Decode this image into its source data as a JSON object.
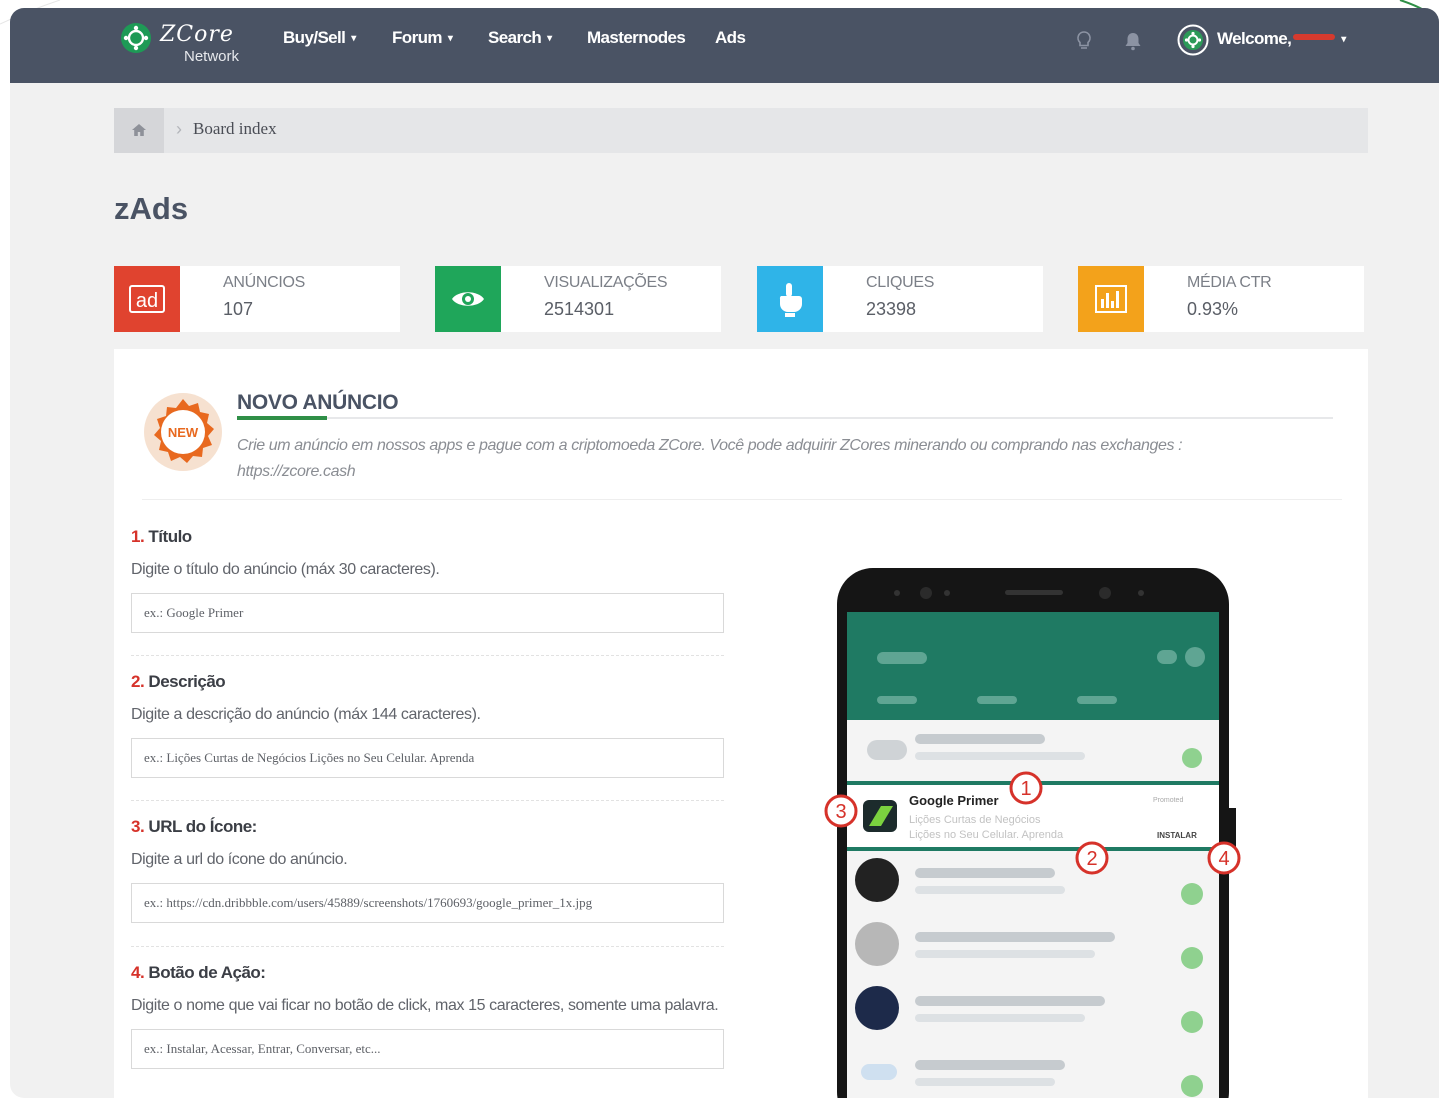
{
  "brand": {
    "logo_script": "ZCore",
    "logo_sub": "Network"
  },
  "nav": {
    "items": [
      {
        "label": "Buy/Sell",
        "dropdown": true
      },
      {
        "label": "Forum",
        "dropdown": true
      },
      {
        "label": "Search",
        "dropdown": true
      },
      {
        "label": "Masternodes",
        "dropdown": false
      },
      {
        "label": "Ads",
        "dropdown": false
      }
    ],
    "caret": "▾",
    "welcome": "Welcome,"
  },
  "breadcrumb": {
    "sep": "›",
    "label": "Board index"
  },
  "page": {
    "title": "zAds"
  },
  "stats": [
    {
      "label": "ANÚNCIOS",
      "value": "107",
      "color": "#e0432f",
      "icon": "ad-icon",
      "icon_text": "ad"
    },
    {
      "label": "VISUALIZAÇÕES",
      "value": "2514301",
      "color": "#1fa65a",
      "icon": "eye-icon"
    },
    {
      "label": "CLIQUES",
      "value": "23398",
      "color": "#2fb4e8",
      "icon": "hand-pointer-icon"
    },
    {
      "label": "MÉDIA CTR",
      "value": "0.93%",
      "color": "#f3a21b",
      "icon": "bar-chart-icon"
    }
  ],
  "new_ad": {
    "badge": "NEW",
    "title": "NOVO ANÚNCIO",
    "description": "Crie um anúncio em nossos apps e pague com a criptomoeda ZCore. Você pode adquirir ZCores minerando ou comprando nas exchanges : https://zcore.cash"
  },
  "fields": [
    {
      "num": "1.",
      "label": "Título",
      "help": "Digite o título do anúncio (máx 30 caracteres).",
      "placeholder": "ex.: Google Primer"
    },
    {
      "num": "2.",
      "label": "Descrição",
      "help": "Digite a descrição do anúncio (máx 144 caracteres).",
      "placeholder": "ex.: Lições Curtas de Negócios Lições no Seu Celular. Aprenda"
    },
    {
      "num": "3.",
      "label": "URL do Ícone:",
      "help": "Digite a url do ícone do anúncio.",
      "placeholder": "ex.: https://cdn.dribbble.com/users/45889/screenshots/1760693/google_primer_1x.jpg"
    },
    {
      "num": "4.",
      "label": "Botão de Ação:",
      "help": "Digite o nome que vai ficar no botão de click, max 15 caracteres, somente uma palavra.",
      "placeholder": "ex.: Instalar, Acessar, Entrar, Conversar, etc..."
    }
  ],
  "preview": {
    "ad_title": "Google Primer",
    "ad_desc_1": "Lições Curtas de Negócios",
    "ad_desc_2": "Lições no Seu Celular. Aprenda",
    "ad_sponsored": "Promoted",
    "ad_button": "INSTALAR",
    "callouts": [
      "1",
      "2",
      "3",
      "4"
    ]
  },
  "colors": {
    "navbar": "#4a5364",
    "accent_red": "#d6322a",
    "accent_green": "#2f8f47",
    "whatsapp_green": "#1f7a63"
  }
}
